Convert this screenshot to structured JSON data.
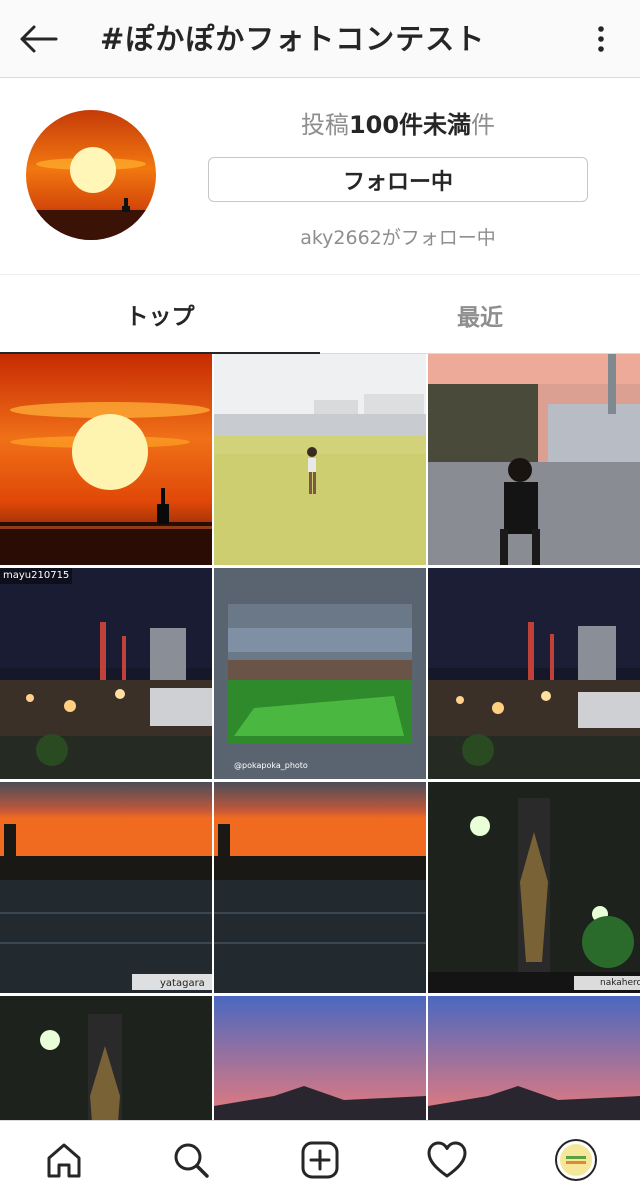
{
  "header": {
    "title": "#ぽかぽかフォトコンテスト",
    "back_icon": "arrow-left-icon",
    "more_icon": "more-vertical-icon"
  },
  "profile": {
    "post_prefix": "投稿",
    "post_count": "100件未満",
    "post_suffix": "件",
    "follow_label": "フォロー中",
    "followed_by": "aky2662がフォロー中"
  },
  "tabs": [
    {
      "label": "トップ",
      "selected": true
    },
    {
      "label": "最近",
      "selected": false
    }
  ],
  "grid": {
    "overlays": {
      "mayu": "mayu210715",
      "pokapoka": "@pokapoka_photo",
      "yatagara": "yatagara",
      "nakaheroc": "nakaheroc"
    }
  },
  "nav": {
    "items": [
      "home-icon",
      "search-icon",
      "add-post-icon",
      "heart-icon",
      "profile-avatar"
    ]
  },
  "colors": {
    "border": "#dbdbdb",
    "secondary_text": "#8e8e8e",
    "primary_text": "#262626"
  }
}
